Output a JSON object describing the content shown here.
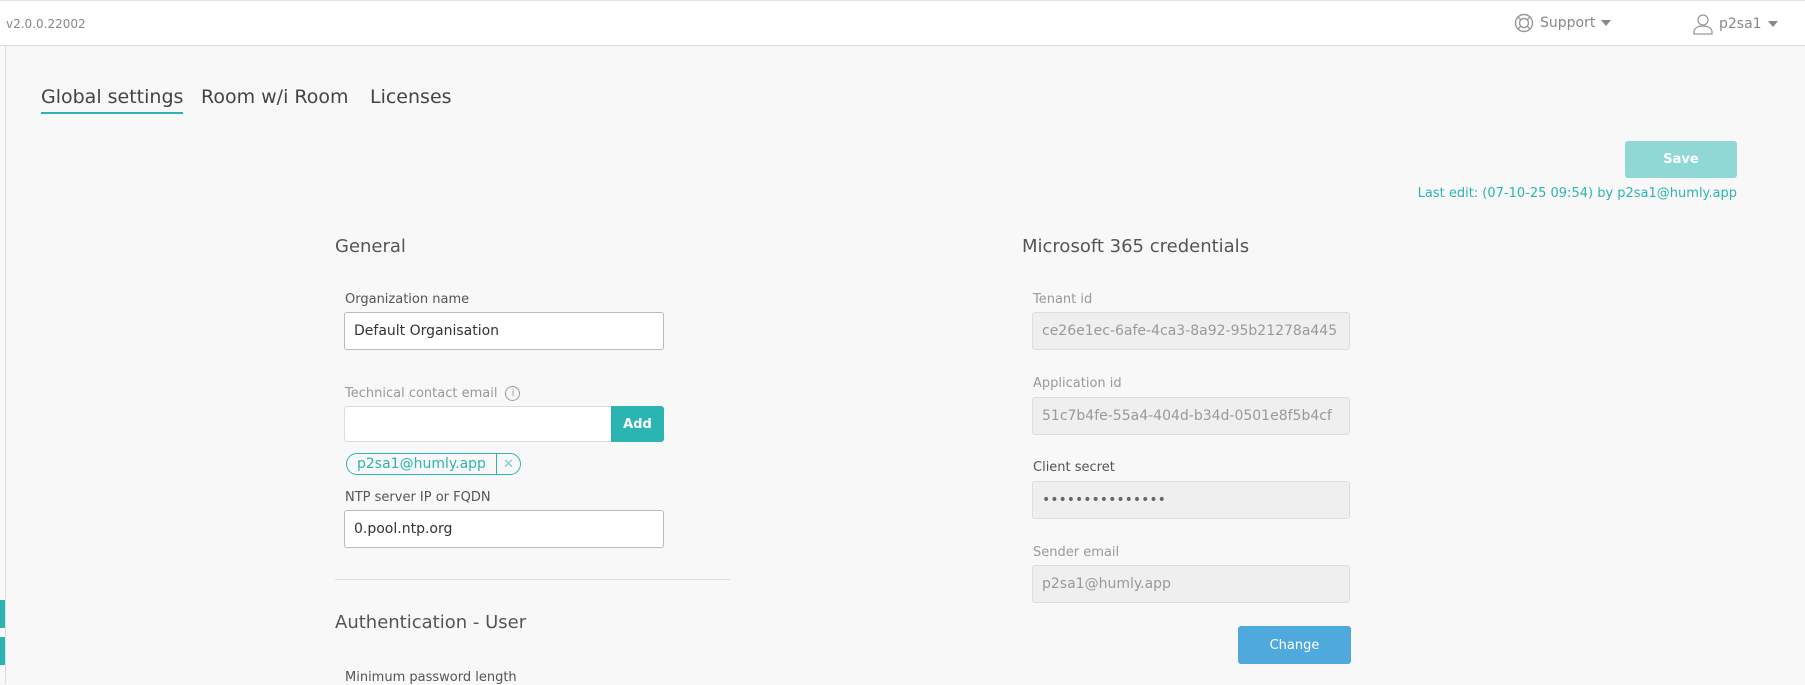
{
  "header": {
    "version": "v2.0.0.22002",
    "support_label": "Support",
    "user_label": "p2sa1"
  },
  "tabs": [
    {
      "label": "Global settings",
      "active": true
    },
    {
      "label": "Room w/i Room"
    },
    {
      "label": "Licenses"
    }
  ],
  "actions": {
    "save_label": "Save",
    "last_edit": "Last edit: (07-10-25 09:54) by p2sa1@humly.app"
  },
  "general": {
    "title": "General",
    "org_name_label": "Organization name",
    "org_name_value": "Default Organisation",
    "tech_email_label": "Technical contact email",
    "tech_email_value": "",
    "add_label": "Add",
    "emails": [
      "p2sa1@humly.app"
    ],
    "ntp_label": "NTP server IP or FQDN",
    "ntp_value": "0.pool.ntp.org"
  },
  "auth": {
    "title": "Authentication - User",
    "min_password_label": "Minimum password length"
  },
  "ms365": {
    "title": "Microsoft 365 credentials",
    "tenant_label": "Tenant id",
    "tenant_value": "ce26e1ec-6afe-4ca3-8a92-95b21278a445",
    "app_label": "Application id",
    "app_value": "51c7b4fe-55a4-404d-b34d-0501e8f5b4cf",
    "secret_label": "Client secret",
    "secret_value": "•••••••••••••••",
    "sender_label": "Sender email",
    "sender_value": "p2sa1@humly.app",
    "change_label": "Change"
  },
  "colors": {
    "accent": "#2bb5b2",
    "change": "#4fa9dc",
    "save_disabled": "#8fd8d6"
  }
}
